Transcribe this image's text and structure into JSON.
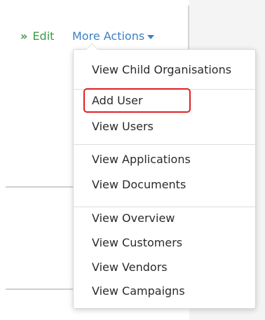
{
  "actions": {
    "edit_label": "Edit",
    "edit_prefix": "»",
    "more_actions_label": "More Actions"
  },
  "menu": {
    "sections": [
      [
        "View Child Organisations"
      ],
      [
        "Add User",
        "View Users"
      ],
      [
        "View Applications",
        "View Documents"
      ],
      [
        "View Overview",
        "View Customers",
        "View Vendors",
        "View Campaigns"
      ]
    ]
  },
  "colors": {
    "edit_link": "#3b9b47",
    "more_actions_link": "#3c7fc4",
    "highlight_border": "#e02020"
  }
}
